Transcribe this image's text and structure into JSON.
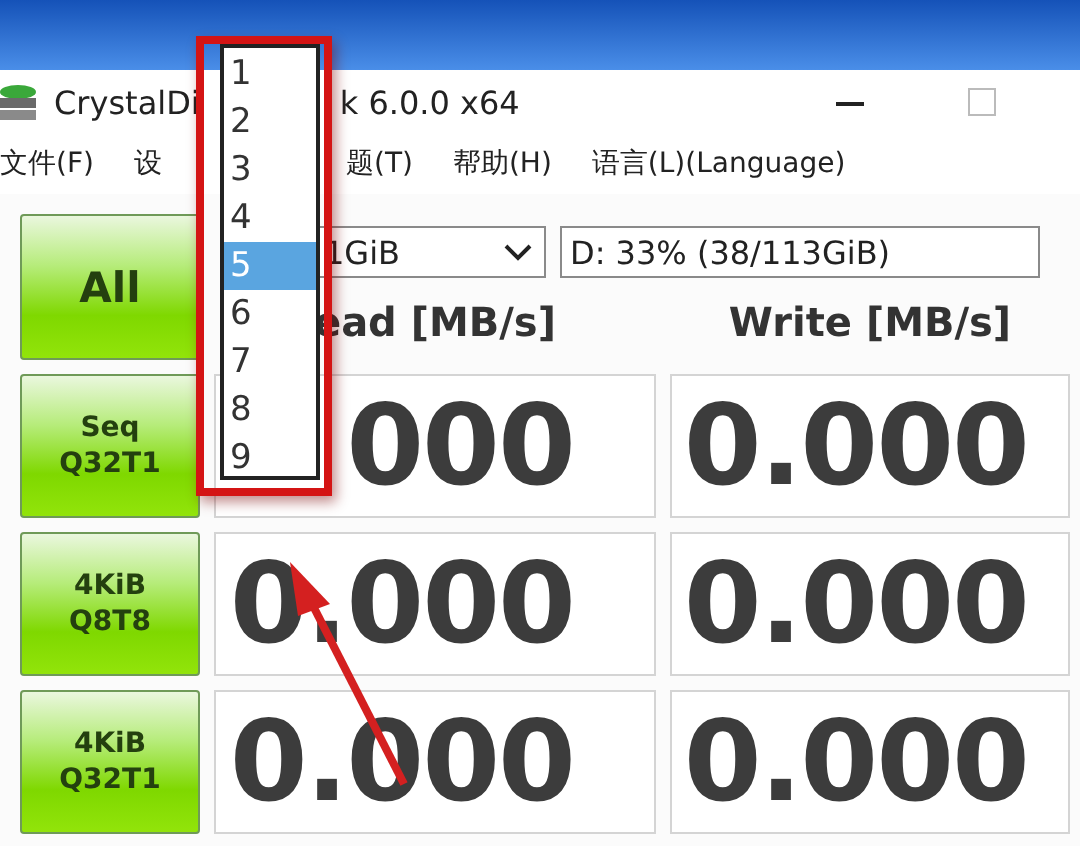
{
  "window": {
    "title_parts": [
      "CrystalDi",
      "k 6.0.0 x64"
    ]
  },
  "menu": [
    "文件(F)",
    "设",
    "题(T)",
    "帮助(H)",
    "语言(L)(Language)"
  ],
  "all_button": "All",
  "size_select": {
    "value": "1GiB"
  },
  "drive_select": {
    "value": "D: 33% (38/113GiB)"
  },
  "headers": [
    "ead [MB/s]",
    "Write [MB/s]"
  ],
  "rows": [
    {
      "test": [
        "Seq",
        "Q32T1"
      ],
      "read": "000",
      "write": "0.000"
    },
    {
      "test": [
        "4KiB",
        "Q8T8"
      ],
      "read": "0.000",
      "write": "0.000"
    },
    {
      "test": [
        "4KiB",
        "Q32T1"
      ],
      "read": "0.000",
      "write": "0.000"
    }
  ],
  "count_list": [
    {
      "label": "1",
      "selected": false
    },
    {
      "label": "2",
      "selected": false
    },
    {
      "label": "3",
      "selected": false
    },
    {
      "label": "4",
      "selected": false
    },
    {
      "label": "5",
      "selected": true
    },
    {
      "label": "6",
      "selected": false
    },
    {
      "label": "7",
      "selected": false
    },
    {
      "label": "8",
      "selected": false
    },
    {
      "label": "9",
      "selected": false
    }
  ]
}
